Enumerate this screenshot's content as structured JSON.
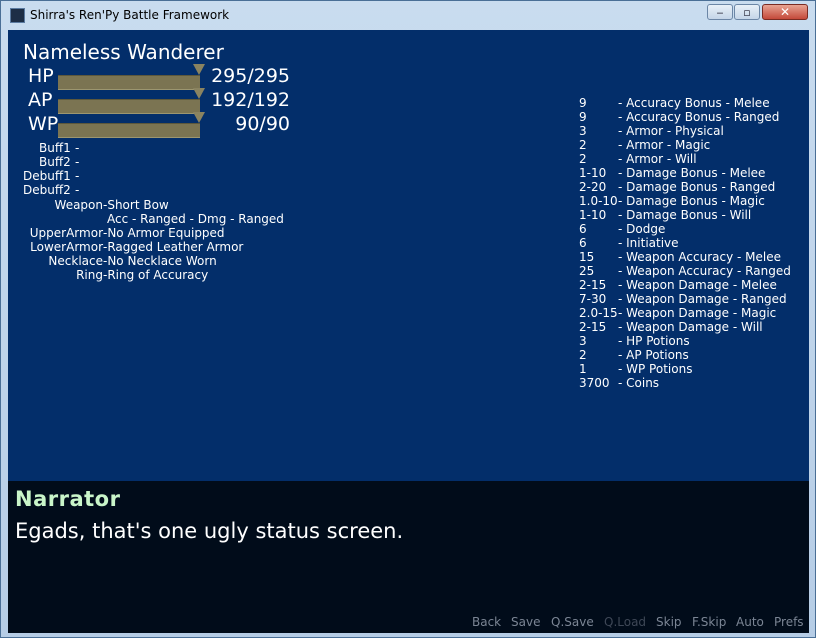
{
  "window": {
    "title": "Shirra's Ren'Py Battle Framework",
    "minimize_glyph": "‒",
    "maximize_glyph": "▫",
    "close_glyph": "✕"
  },
  "character": {
    "name": "Nameless Wanderer"
  },
  "stats": [
    {
      "label": "HP",
      "value": "295/295",
      "fraction": 1.0
    },
    {
      "label": "AP",
      "value": "192/192",
      "fraction": 1.0
    },
    {
      "label": "WP",
      "value": "90/90",
      "fraction": 1.0
    }
  ],
  "effects": [
    {
      "label": "Buff1",
      "value": "-"
    },
    {
      "label": "Buff2",
      "value": "-"
    },
    {
      "label": "Debuff1",
      "value": "-"
    },
    {
      "label": "Debuff2",
      "value": "-"
    }
  ],
  "equipment": {
    "weapon_label": "Weapon",
    "weapon_value": "-Short Bow",
    "weapon_sub": "Acc - Ranged - Dmg - Ranged",
    "upper_label": "UpperArmor",
    "upper_value": "-No Armor Equipped",
    "lower_label": "LowerArmor",
    "lower_value": "-Ragged Leather Armor",
    "necklace_label": "Necklace",
    "necklace_value": "-No Necklace Worn",
    "ring_label": "Ring",
    "ring_value": "-Ring of Accuracy"
  },
  "attributes": [
    {
      "value": "9",
      "desc": "- Accuracy Bonus - Melee"
    },
    {
      "value": "9",
      "desc": "- Accuracy Bonus - Ranged"
    },
    {
      "value": "3",
      "desc": "- Armor - Physical"
    },
    {
      "value": "2",
      "desc": "- Armor - Magic"
    },
    {
      "value": "2",
      "desc": "- Armor - Will"
    },
    {
      "value": "1-10",
      "desc": "- Damage Bonus - Melee"
    },
    {
      "value": "2-20",
      "desc": "- Damage Bonus - Ranged"
    },
    {
      "value": "1.0-10",
      "desc": "- Damage Bonus - Magic"
    },
    {
      "value": "1-10",
      "desc": "- Damage Bonus - Will"
    },
    {
      "value": "6",
      "desc": "- Dodge"
    },
    {
      "value": "6",
      "desc": "- Initiative"
    },
    {
      "value": "15",
      "desc": "- Weapon Accuracy - Melee"
    },
    {
      "value": "25",
      "desc": "- Weapon Accuracy - Ranged"
    },
    {
      "value": "2-15",
      "desc": "- Weapon Damage - Melee"
    },
    {
      "value": "7-30",
      "desc": "- Weapon Damage - Ranged"
    },
    {
      "value": "2.0-15",
      "desc": "- Weapon Damage - Magic"
    },
    {
      "value": "2-15",
      "desc": "- Weapon Damage - Will"
    },
    {
      "value": "3",
      "desc": "- HP Potions"
    },
    {
      "value": "2",
      "desc": "- AP Potions"
    },
    {
      "value": "1",
      "desc": "- WP Potions"
    },
    {
      "value": "3700",
      "desc": "- Coins"
    }
  ],
  "dialogue": {
    "speaker": "Narrator",
    "text": "Egads, that's one ugly status screen."
  },
  "quick_menu": [
    {
      "label": "Back",
      "enabled": true
    },
    {
      "label": "Save",
      "enabled": true
    },
    {
      "label": "Q.Save",
      "enabled": true
    },
    {
      "label": "Q.Load",
      "enabled": false
    },
    {
      "label": "Skip",
      "enabled": true
    },
    {
      "label": "F.Skip",
      "enabled": true
    },
    {
      "label": "Auto",
      "enabled": true
    },
    {
      "label": "Prefs",
      "enabled": true
    }
  ]
}
